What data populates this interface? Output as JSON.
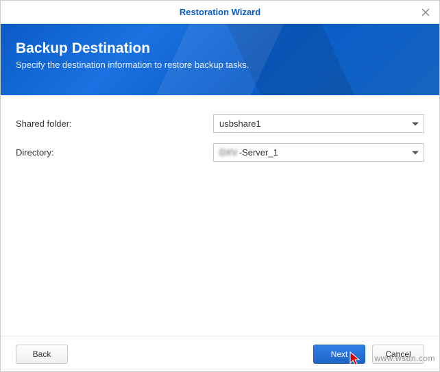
{
  "window": {
    "title": "Restoration Wizard"
  },
  "banner": {
    "title": "Backup Destination",
    "subtitle": "Specify the destination information to restore backup tasks."
  },
  "form": {
    "shared_folder_label": "Shared folder:",
    "shared_folder_value": "usbshare1",
    "directory_label": "Directory:",
    "directory_prefix": "DXV",
    "directory_suffix": "-Server_1"
  },
  "footer": {
    "back": "Back",
    "next": "Next",
    "cancel": "Cancel"
  },
  "watermark": "www.wsdn.com"
}
